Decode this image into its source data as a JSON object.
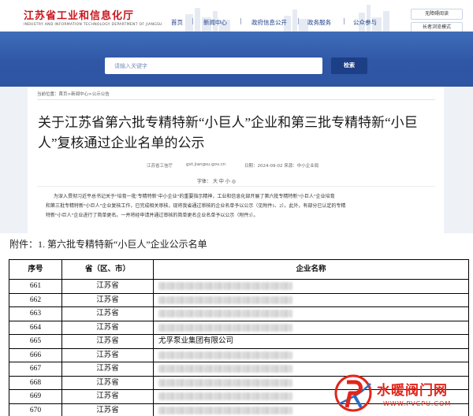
{
  "header": {
    "site_title": "江苏省工业和信息化厅",
    "site_subtitle": "INDUSTRY AND INFORMATION TECHNOLOGY DEPARTMENT OF JIANGSU",
    "nav": [
      "首页",
      "新闻中心",
      "政府信息公开",
      "政务服务",
      "公众参与"
    ],
    "tools": [
      "无障碍阅读",
      "长者浏览模式"
    ]
  },
  "search": {
    "placeholder": "请输入关键字",
    "button_label": "检索"
  },
  "article": {
    "breadcrumb": "当前位置：首页>新闻中心>公示公告",
    "title": "关于江苏省第六批专精特新“小巨人”企业和第三批专精特新“小巨人”复核通过企业名单的公示",
    "meta": {
      "source": "江苏省工信厅",
      "url": "gxt.jiangsu.gov.cn",
      "date": "日期：2024-09-02 来源：中小企业局"
    },
    "font_control": {
      "label": "字体：",
      "large": "大",
      "medium": "中",
      "small": "小",
      "icon": "◎"
    },
    "body_lines": [
      "为深入贯彻习近平总书记关于“培育一批‘专精特新’中小企业”的重要指示精神，工业和信息化部开展了第六批专精特新“小巨人”企业培育",
      "和第三批专精特新“小巨人”企业复核工作，已完成相关审核，现将我省通过审核的企业名单予以公示（见附件1、2）。此外，有部分已认定的专精",
      "特新“小巨人”企业进行了简单更名。一并将经申请并通过审核的简单更名企业名单予以公示（附件3）。"
    ]
  },
  "attachment": {
    "heading": "附件：1. 第六批专精特新“小巨人”企业公示名单"
  },
  "table": {
    "headers": [
      "序号",
      "省（区、市）",
      "企业名称"
    ],
    "rows": [
      {
        "no": "661",
        "prov": "江苏省",
        "name": ""
      },
      {
        "no": "662",
        "prov": "江苏省",
        "name": ""
      },
      {
        "no": "663",
        "prov": "江苏省",
        "name": ""
      },
      {
        "no": "664",
        "prov": "江苏省",
        "name": ""
      },
      {
        "no": "665",
        "prov": "江苏省",
        "name": "尤孚泵业集团有限公司"
      },
      {
        "no": "666",
        "prov": "江苏省",
        "name": ""
      },
      {
        "no": "667",
        "prov": "江苏省",
        "name": ""
      },
      {
        "no": "668",
        "prov": "江苏省",
        "name": ""
      },
      {
        "no": "669",
        "prov": "江苏省",
        "name": ""
      },
      {
        "no": "670",
        "prov": "江苏省",
        "name": ""
      }
    ]
  },
  "watermark": {
    "brand_text": "水暖阀门网",
    "url": "WWW.PVCPU.COM"
  },
  "colors": {
    "brand_red": "#c8161d",
    "nav_blue": "#1f3f88",
    "search_band": "#2f57a6",
    "search_button": "#1c3f86",
    "watermark_red": "#e1251b"
  }
}
